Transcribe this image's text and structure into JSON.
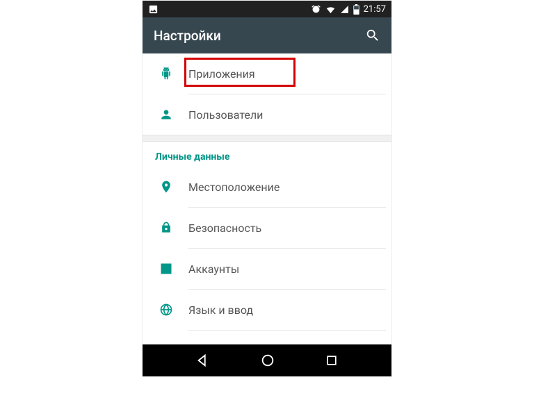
{
  "status": {
    "time": "21:57"
  },
  "appbar": {
    "title": "Настройки"
  },
  "items": {
    "apps": "Приложения",
    "users": "Пользователи",
    "location": "Местоположение",
    "security": "Безопасность",
    "accounts": "Аккаунты",
    "lang": "Язык и ввод"
  },
  "sections": {
    "personal": "Личные данные"
  },
  "colors": {
    "accent": "#009688",
    "highlight": "#d40000",
    "appbar_bg": "#37474F"
  }
}
